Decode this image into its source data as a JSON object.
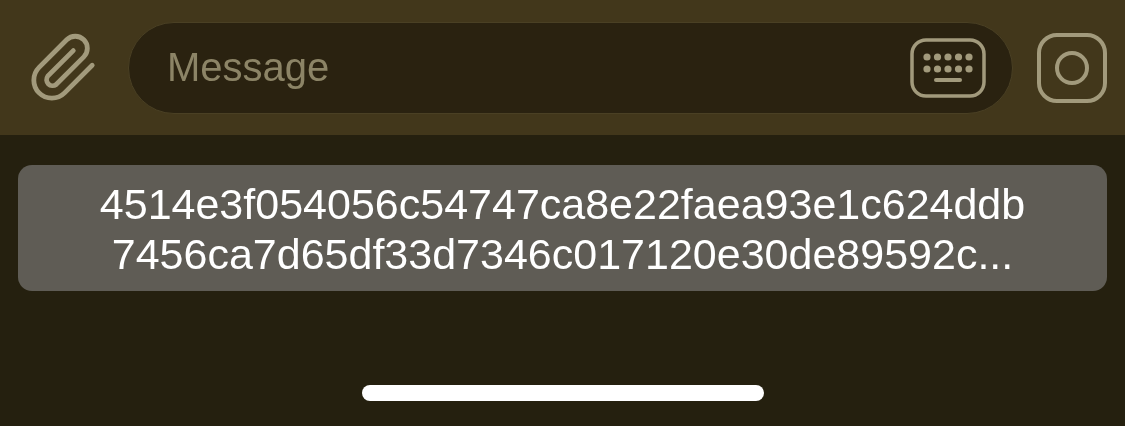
{
  "composer": {
    "placeholder": "Message"
  },
  "message": {
    "text": "4514e3f054056c54747ca8e22faea93e1c624ddb\n7456ca7d65df33d7346c017120e30de89592c..."
  }
}
